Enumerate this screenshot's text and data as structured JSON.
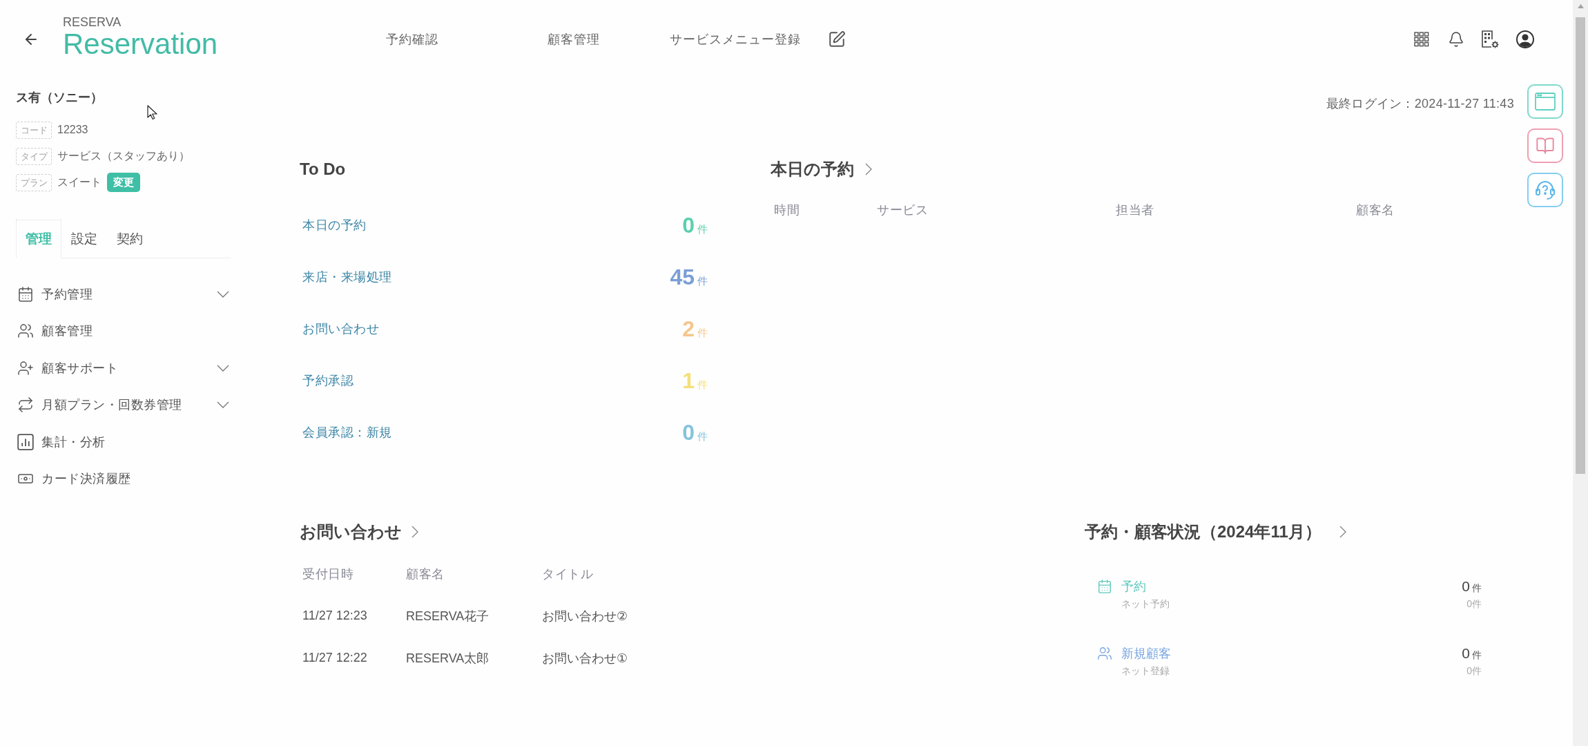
{
  "header": {
    "brand": "RESERVA",
    "logo": "Reservation",
    "nav": [
      {
        "label": "予約確認"
      },
      {
        "label": "顧客管理"
      },
      {
        "label": "サービスメニュー登録"
      }
    ]
  },
  "account": {
    "name": "ス有（ソニー）",
    "fields": [
      {
        "tag": "コード",
        "value": "12233"
      },
      {
        "tag": "タイプ",
        "value": "サービス（スタッフあり）"
      },
      {
        "tag": "プラン",
        "value": "スイート",
        "action": "変更"
      }
    ]
  },
  "sidebar": {
    "tabs": [
      {
        "label": "管理",
        "selected": true
      },
      {
        "label": "設定",
        "selected": false
      },
      {
        "label": "契約",
        "selected": false
      }
    ],
    "menu": [
      {
        "label": "予約管理",
        "kind": "group"
      },
      {
        "label": "顧客管理",
        "kind": "link"
      },
      {
        "label": "顧客サポート",
        "kind": "group"
      },
      {
        "label": "月額プラン・回数券管理",
        "kind": "group"
      },
      {
        "label": "集計・分析",
        "kind": "link"
      },
      {
        "label": "カード決済履歴",
        "kind": "link"
      }
    ]
  },
  "last_login": "最終ログイン：2024-11-27 11:43",
  "todo": {
    "title": "To Do",
    "items": [
      {
        "label": "本日の予約",
        "count": "0",
        "unit": "件",
        "color": "#5ccfae"
      },
      {
        "label": "来店・来場処理",
        "count": "45",
        "unit": "件",
        "color": "#7b9fd6"
      },
      {
        "label": "お問い合わせ",
        "count": "2",
        "unit": "件",
        "color": "#f5c68c"
      },
      {
        "label": "予約承認",
        "count": "1",
        "unit": "件",
        "color": "#f4e07a"
      },
      {
        "label": "会員承認：新規",
        "count": "0",
        "unit": "件",
        "color": "#86c3dc"
      }
    ]
  },
  "today": {
    "title": "本日の予約",
    "columns": [
      "時間",
      "サービス",
      "担当者",
      "顧客名"
    ]
  },
  "inquiries": {
    "title": "お問い合わせ",
    "columns": [
      "受付日時",
      "顧客名",
      "タイトル"
    ],
    "rows": [
      [
        "11/27 12:23",
        "RESERVA花子",
        "お問い合わせ②"
      ],
      [
        "11/27 12:22",
        "RESERVA太郎",
        "お問い合わせ①"
      ]
    ]
  },
  "status": {
    "title": "予約・顧客状況（2024年11月）",
    "items": [
      {
        "label": "予約",
        "sublabel": "ネット予約",
        "count": "0",
        "unit": "件",
        "sub_count": "0件",
        "color": "#5cc8bc"
      },
      {
        "label": "新規顧客",
        "sublabel": "ネット登録",
        "count": "0",
        "unit": "件",
        "sub_count": "0件",
        "color": "#7aa6e0"
      }
    ]
  }
}
